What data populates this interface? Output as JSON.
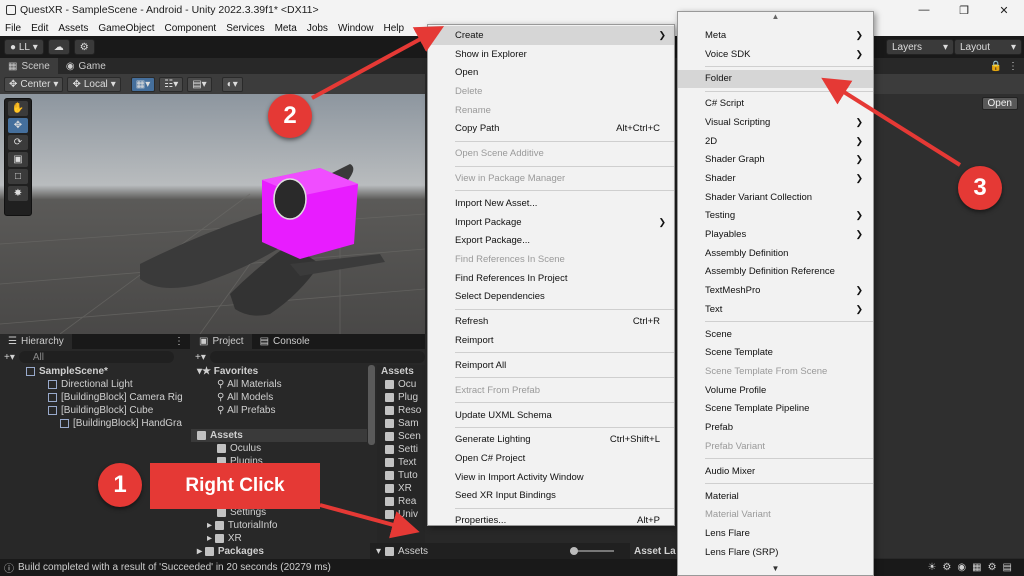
{
  "window": {
    "title": "QuestXR - SampleScene - Android - Unity 2022.3.39f1* <DX11>",
    "controls": [
      "—",
      "❐",
      "✕"
    ]
  },
  "menubar": [
    "File",
    "Edit",
    "Assets",
    "GameObject",
    "Component",
    "Services",
    "Meta",
    "Jobs",
    "Window",
    "Help"
  ],
  "toolbar": {
    "account": "LL",
    "layers": "Layers",
    "layout": "Layout"
  },
  "scene_tabs": [
    "Scene",
    "Game"
  ],
  "scene_tools": {
    "pivot": "Center",
    "space": "Local"
  },
  "hierarchy": {
    "tab": "Hierarchy",
    "search_placeholder": "All",
    "items": [
      "SampleScene*",
      "Directional Light",
      "[BuildingBlock] Camera Rig",
      "[BuildingBlock] Cube",
      "[BuildingBlock] HandGra"
    ]
  },
  "project": {
    "tabs": [
      "Project",
      "Console"
    ],
    "favorites_label": "Favorites",
    "favorites": [
      "All Materials",
      "All Models",
      "All Prefabs"
    ],
    "assets_label": "Assets",
    "asset_folders": [
      "Oculus",
      "Plugins"
    ],
    "lower_folders": [
      "Settings",
      "TutorialInfo",
      "XR"
    ],
    "packages_label": "Packages",
    "right_header": "Assets",
    "right_items": [
      "Ocu",
      "Plug",
      "Reso",
      "Sam",
      "Scen",
      "Setti",
      "Text",
      "Tuto",
      "XR",
      "Rea",
      "Univ"
    ],
    "breadcrumb": "Assets",
    "asset_label_header": "Asset La"
  },
  "inspector": {
    "open_button": "Open"
  },
  "status": "Build completed with a result of 'Succeeded' in 20 seconds (20279 ms)",
  "context_menu": [
    {
      "label": "Create",
      "arrow": true,
      "highlight": true
    },
    {
      "label": "Show in Explorer"
    },
    {
      "label": "Open"
    },
    {
      "label": "Delete",
      "disabled": true
    },
    {
      "label": "Rename",
      "disabled": true
    },
    {
      "label": "Copy Path",
      "shortcut": "Alt+Ctrl+C"
    },
    {
      "sep": true
    },
    {
      "label": "Open Scene Additive",
      "disabled": true
    },
    {
      "sep": true
    },
    {
      "label": "View in Package Manager",
      "disabled": true
    },
    {
      "sep": true
    },
    {
      "label": "Import New Asset..."
    },
    {
      "label": "Import Package",
      "arrow": true
    },
    {
      "label": "Export Package..."
    },
    {
      "label": "Find References In Scene",
      "disabled": true
    },
    {
      "label": "Find References In Project"
    },
    {
      "label": "Select Dependencies"
    },
    {
      "sep": true
    },
    {
      "label": "Refresh",
      "shortcut": "Ctrl+R"
    },
    {
      "label": "Reimport"
    },
    {
      "sep": true
    },
    {
      "label": "Reimport All"
    },
    {
      "sep": true
    },
    {
      "label": "Extract From Prefab",
      "disabled": true
    },
    {
      "sep": true
    },
    {
      "label": "Update UXML Schema"
    },
    {
      "sep": true
    },
    {
      "label": "Generate Lighting",
      "shortcut": "Ctrl+Shift+L"
    },
    {
      "label": "Open C# Project"
    },
    {
      "label": "View in Import Activity Window"
    },
    {
      "label": "Seed XR Input Bindings"
    },
    {
      "sep": true
    },
    {
      "label": "Properties...",
      "shortcut": "Alt+P"
    }
  ],
  "create_submenu": [
    {
      "label": "Meta",
      "arrow": true
    },
    {
      "label": "Voice SDK",
      "arrow": true
    },
    {
      "sep": true
    },
    {
      "label": "Folder",
      "highlight": true
    },
    {
      "sep": true
    },
    {
      "label": "C# Script"
    },
    {
      "label": "Visual Scripting",
      "arrow": true
    },
    {
      "label": "2D",
      "arrow": true
    },
    {
      "label": "Shader Graph",
      "arrow": true
    },
    {
      "label": "Shader",
      "arrow": true
    },
    {
      "label": "Shader Variant Collection"
    },
    {
      "label": "Testing",
      "arrow": true
    },
    {
      "label": "Playables",
      "arrow": true
    },
    {
      "label": "Assembly Definition"
    },
    {
      "label": "Assembly Definition Reference"
    },
    {
      "label": "TextMeshPro",
      "arrow": true
    },
    {
      "label": "Text",
      "arrow": true
    },
    {
      "sep": true
    },
    {
      "label": "Scene"
    },
    {
      "label": "Scene Template"
    },
    {
      "label": "Scene Template From Scene",
      "disabled": true
    },
    {
      "label": "Volume Profile"
    },
    {
      "label": "Scene Template Pipeline"
    },
    {
      "label": "Prefab"
    },
    {
      "label": "Prefab Variant",
      "disabled": true
    },
    {
      "sep": true
    },
    {
      "label": "Audio Mixer"
    },
    {
      "sep": true
    },
    {
      "label": "Material"
    },
    {
      "label": "Material Variant",
      "disabled": true
    },
    {
      "label": "Lens Flare"
    },
    {
      "label": "Lens Flare (SRP)"
    }
  ],
  "annotations": {
    "step1": "1",
    "step2": "2",
    "step3": "3",
    "right_click_label": "Right Click",
    "color": "#e53935"
  }
}
